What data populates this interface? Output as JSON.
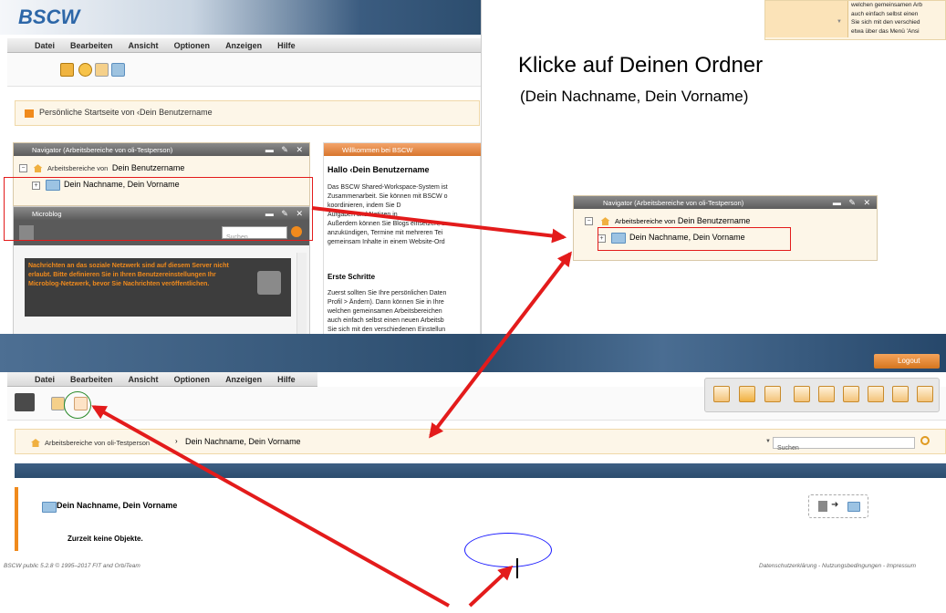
{
  "instruction": {
    "title": "Klicke auf Deinen Ordner",
    "subtitle": "(Dein Nachname, Dein Vorname)"
  },
  "top_window": {
    "logo": "BSCW",
    "menu": [
      "Datei",
      "Bearbeiten",
      "Ansicht",
      "Optionen",
      "Anzeigen",
      "Hilfe"
    ],
    "home_line": "Persönliche Startseite von ‹Dein Benutzername"
  },
  "navigator": {
    "title": "Navigator (Arbeitsbereiche von oli-Testperson)",
    "root_label": "Arbeitsbereiche von",
    "root_user": "Dein Benutzername",
    "folder": "Dein Nachname, Dein Vorname"
  },
  "microblog": {
    "title": "Microblog",
    "search_placeholder": "Suchen",
    "notice": "Nachrichten an das soziale Netzwerk sind auf diesem Server nicht erlaubt. Bitte definieren Sie in Ihren Benutzereinstellungen Ihr Microblog-Netzwerk, bevor Sie Nachrichten veröffentlichen."
  },
  "welcome": {
    "title": "Willkommen bei BSCW",
    "greeting": "Hallo ‹Dein Benutzername",
    "lines": [
      "Das BSCW Shared-Workspace-System ist",
      "Zusammenarbeit. Sie können mit BSCW o",
      "koordinieren, indem Sie D",
      "Aufgaben und Notizen in",
      "Außerdem können Sie Blogs einsetzen, u",
      "anzukündigen, Termine mit mehreren Tei",
      "gemeinsam Inhalte in einem Website-Ord"
    ],
    "section": "Erste Schritte",
    "lines2": [
      "Zuerst sollten Sie Ihre persönlichen Daten",
      "Profil > Ändern). Dann können Sie in Ihre",
      "welchen gemeinsamen Arbeitsbereichen",
      "auch einfach selbst einen neuen Arbeitsb",
      "Sie sich mit den verschiedenen Einstellun"
    ]
  },
  "top_right_fragment": {
    "lines": [
      "welchen gemeinsamen Arb",
      "auch einfach selbst einen",
      "Sie sich mit den verschied",
      "etwa über das Menü 'Ansi"
    ]
  },
  "zoom_navigator": {
    "title": "Navigator (Arbeitsbereiche von oli-Testperson)",
    "root_label": "Arbeitsbereiche von",
    "root_user": "Dein Benutzername",
    "folder": "Dein Nachname, Dein Vorname"
  },
  "bottom_window": {
    "logout": "Logout",
    "menu": [
      "Datei",
      "Bearbeiten",
      "Ansicht",
      "Optionen",
      "Anzeigen",
      "Hilfe"
    ],
    "breadcrumb_root": "Arbeitsbereiche von oli-Testperson",
    "breadcrumb_folder": "Dein Nachname, Dein Vorname",
    "search_label": "Suchen",
    "folder_title": "Dein Nachname, Dein Vorname",
    "empty_message": "Zurzeit keine Objekte.",
    "footer_left": "BSCW public 5.2.8 © 1995–2017 FIT and OrbiTeam",
    "footer_right": "Datenschutzerklärung - Nutzungsbedingungen - Impressum"
  },
  "colors": {
    "annotation_red": "#e31b1b",
    "annotation_green": "#2a8a2a",
    "annotation_blue": "#1a1aff",
    "header_blue": "#2c4d6e",
    "accent_orange": "#f08a1c"
  }
}
